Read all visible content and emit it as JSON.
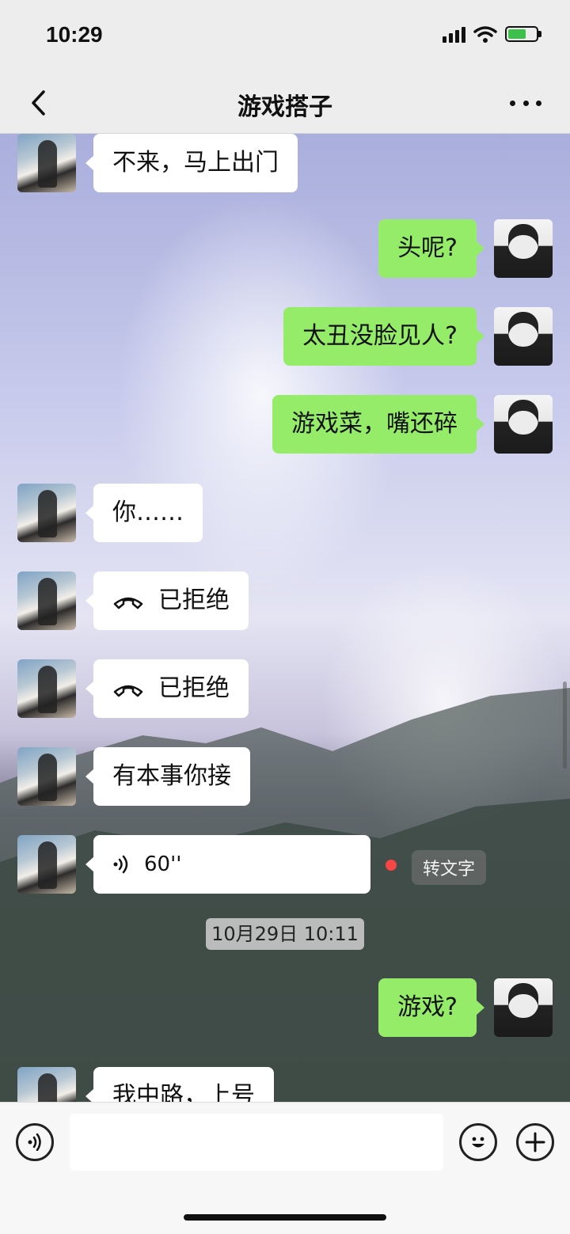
{
  "status_bar": {
    "time": "10:29"
  },
  "nav": {
    "title": "游戏搭子"
  },
  "messages": [
    {
      "side": "left",
      "text": "不来，马上出门"
    },
    {
      "side": "right",
      "text": "头呢?"
    },
    {
      "side": "right",
      "text": "太丑没脸见人?"
    },
    {
      "side": "right",
      "text": "游戏菜，嘴还碎"
    },
    {
      "side": "left",
      "text": "你……"
    },
    {
      "side": "left",
      "type": "call",
      "text": "已拒绝"
    },
    {
      "side": "left",
      "type": "call",
      "text": "已拒绝"
    },
    {
      "side": "left",
      "text": "有本事你接"
    },
    {
      "side": "left",
      "type": "voice",
      "duration": "60''",
      "to_text": "转文字"
    },
    {
      "side": "right",
      "text": "游戏?"
    },
    {
      "side": "left",
      "text": "我中路，上号"
    }
  ],
  "timestamp": "10月29日 10:11",
  "input": {
    "value": "",
    "placeholder": ""
  },
  "icons": {
    "back": "chevron-left-icon",
    "more": "more-dots-icon",
    "call": "phone-declined-icon",
    "voice": "voice-wave-icon",
    "emoji": "emoji-icon",
    "plus": "plus-icon"
  }
}
